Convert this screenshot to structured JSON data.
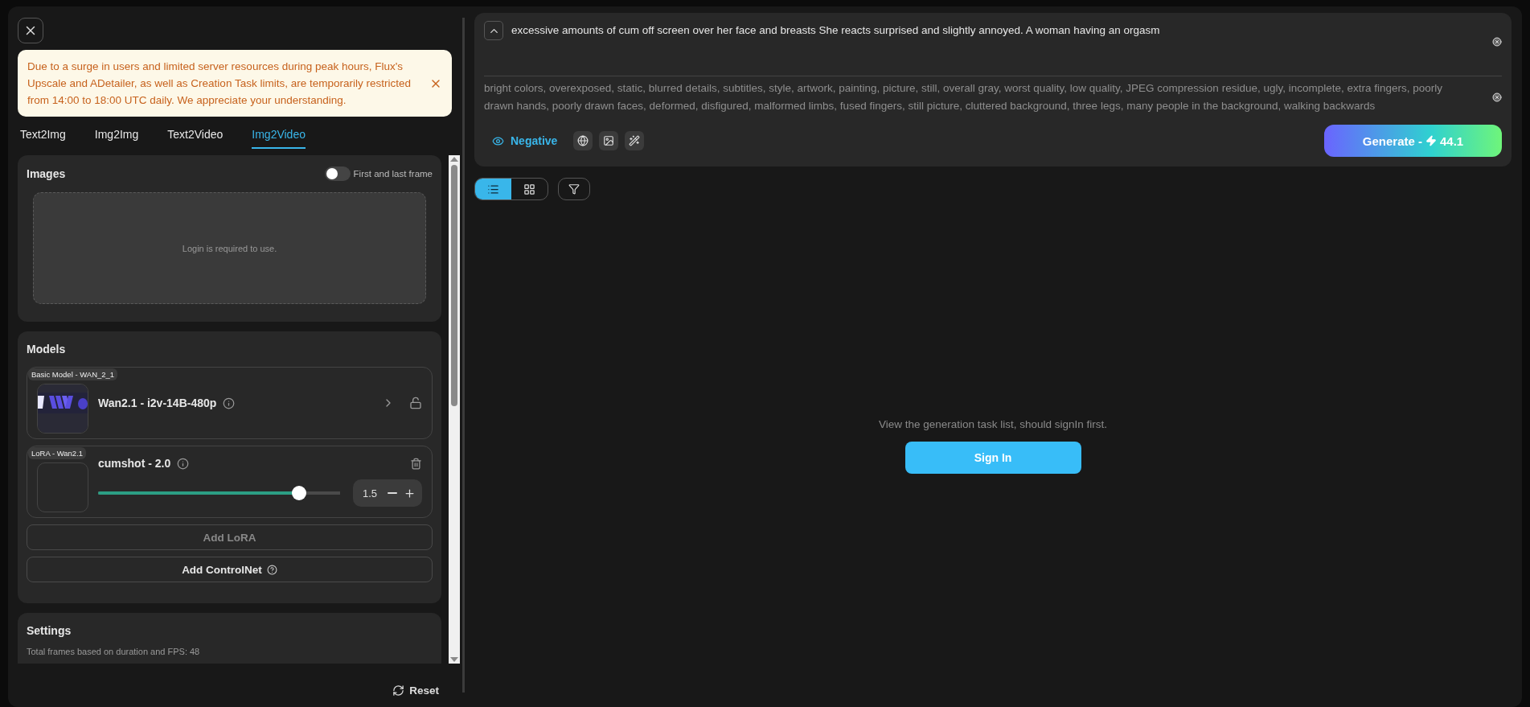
{
  "notice": {
    "text": "Due to a surge in users and limited server resources during peak hours, Flux's Upscale and ADetailer, as well as Creation Task limits, are temporarily restricted from 14:00 to 18:00 UTC daily. We appreciate your understanding."
  },
  "tabs": [
    {
      "label": "Text2Img",
      "selected": false
    },
    {
      "label": "Img2Img",
      "selected": false
    },
    {
      "label": "Text2Video",
      "selected": false
    },
    {
      "label": "Img2Video",
      "selected": true
    }
  ],
  "images": {
    "title": "Images",
    "toggle": {
      "label": "First and last frame",
      "on": false
    },
    "dropzone": "Login is required to use."
  },
  "models": {
    "title": "Models",
    "base": {
      "tag": "Basic Model - WAN_2_1",
      "name": "Wan2.1 - i2v-14B-480p"
    },
    "lora": {
      "tag": "LoRA - Wan2.1",
      "name": "cumshot - 2.0",
      "level": 0.85,
      "value": "1.5"
    },
    "buttons": [
      {
        "label": "Add LoRA",
        "disabled": true,
        "help": false
      },
      {
        "label": "Add ControlNet",
        "disabled": false,
        "help": true
      }
    ]
  },
  "settings": {
    "title": "Settings",
    "note": "Total frames based on duration and FPS: 48"
  },
  "reset": "Reset",
  "prompt": {
    "text": "excessive amounts of cum off screen over her face and breasts She reacts surprised and slightly annoyed. A woman having an orgasm",
    "negative": "bright colors, overexposed, static, blurred details, subtitles, style, artwork, painting, picture, still, overall gray, worst quality, low quality, JPEG compression residue, ugly, incomplete, extra fingers, poorly drawn hands, poorly drawn faces, deformed, disfigured, malformed limbs, fused fingers, still picture, cluttered background, three legs, many people in the background, walking backwards"
  },
  "negative_toggle": {
    "label": "Negative",
    "on": true
  },
  "generate": {
    "label": "Generate -",
    "cost": "44.1"
  },
  "view_modes": [
    {
      "kind": "list",
      "selected": true
    },
    {
      "kind": "grid",
      "selected": false
    }
  ],
  "tasks": {
    "message": "View the generation task list, should signIn first.",
    "button": "Sign In"
  }
}
